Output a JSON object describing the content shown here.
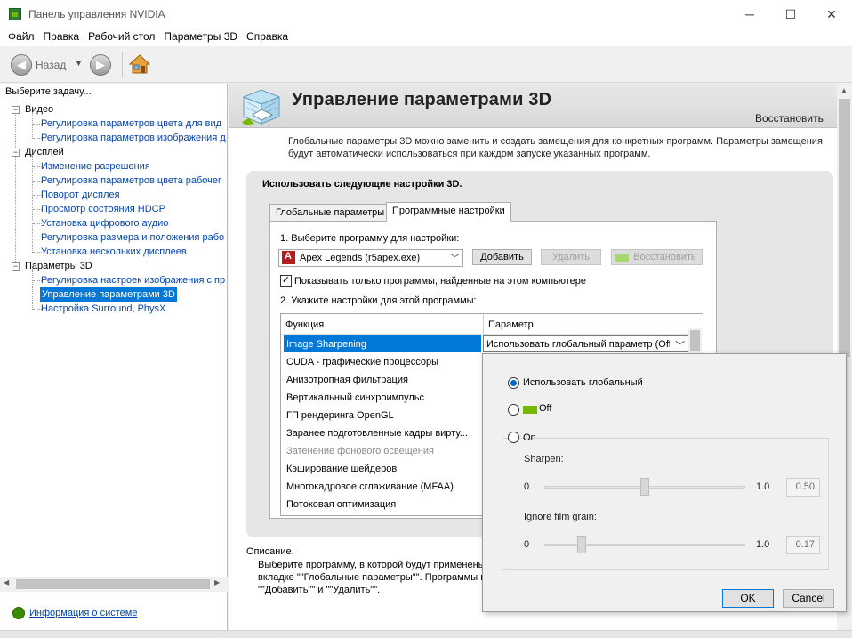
{
  "window": {
    "title": "Панель управления NVIDIA",
    "controls": {
      "minimize": "─",
      "maximize": "☐",
      "close": "✕"
    }
  },
  "menu": [
    "Файл",
    "Правка",
    "Рабочий стол",
    "Параметры 3D",
    "Справка"
  ],
  "toolbar": {
    "back_label": "Назад",
    "back_dropdown": "▼"
  },
  "left_panel": {
    "prompt": "Выберите задачу...",
    "groups": [
      {
        "label": "Видео",
        "items": [
          "Регулировка параметров цвета для вид",
          "Регулировка параметров изображения д"
        ]
      },
      {
        "label": "Дисплей",
        "items": [
          "Изменение разрешения",
          "Регулировка параметров цвета рабочег",
          "Поворот дисплея",
          "Просмотр состояния HDCP",
          "Установка цифрового аудио",
          "Регулировка размера и положения рабо",
          "Установка нескольких дисплеев"
        ]
      },
      {
        "label": "Параметры 3D",
        "items": [
          "Регулировка настроек изображения с пр",
          "Управление параметрами 3D",
          "Настройка Surround, PhysX"
        ]
      }
    ],
    "selected_item": "Управление параметрами 3D",
    "system_info_link": "Информация о системе"
  },
  "main": {
    "title": "Управление параметрами 3D",
    "restore": "Восстановить",
    "intro_line1": "Глобальные параметры 3D можно заменить и создать замещения для конкретных программ. Параметры замещения",
    "intro_line2": "будут автоматически использоваться при каждом запуске указанных программ.",
    "use_settings_label": "Использовать следующие настройки 3D.",
    "tabs": [
      {
        "label": "Глобальные параметры"
      },
      {
        "label": "Программные настройки"
      }
    ],
    "active_tab": "Программные настройки",
    "step1": "1. Выберите программу для настройки:",
    "program": "Apex Legends (r5apex.exe)",
    "buttons": {
      "add": "Добавить",
      "delete": "Удалить",
      "restore": "Восстановить"
    },
    "show_only_checkbox": {
      "label": "Показывать только программы, найденные на этом компьютере",
      "checked": true
    },
    "step2": "2. Укажите настройки для этой программы:",
    "table": {
      "headers": [
        "Функция",
        "Параметр"
      ],
      "selected_feature": "Image Sharpening",
      "selected_value": "Использовать глобальный параметр (Off)",
      "rows": [
        "CUDA - графические процессоры",
        "Анизотропная фильтрация",
        "Вертикальный синхроимпульс",
        "ГП рендеринга OpenGL",
        "Заранее подготовленные кадры вирту...",
        "Затенение фонового освещения",
        "Кэширование шейдеров",
        "Многокадровое сглаживание (MFAA)",
        "Потоковая оптимизация"
      ],
      "dim_rows": [
        "Затенение фонового освещения"
      ]
    },
    "description_label": "Описание.",
    "description_lines": [
      "Выберите программу, в которой будут применены",
      "вкладке \"\"Глобальные параметры\"\". Программы в",
      "\"\"Добавить\"\" и \"\"Удалить\"\"."
    ]
  },
  "popup": {
    "radio_global": "Использовать глобальный",
    "radio_off": "Off",
    "radio_on": "On",
    "selected": "global",
    "sharpen": {
      "label": "Sharpen:",
      "min": "0",
      "max": "1.0",
      "value": "0.50",
      "level": 0.5
    },
    "grain": {
      "label": "Ignore film grain:",
      "min": "0",
      "max": "1.0",
      "value": "0.17",
      "level": 0.17
    },
    "ok": "OK",
    "cancel": "Cancel"
  },
  "colors": {
    "accent": "#0078d7",
    "nvidia_green": "#76b900",
    "link": "#0645ad"
  }
}
